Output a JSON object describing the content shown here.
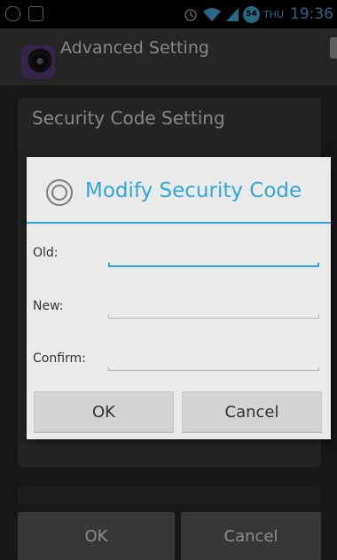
{
  "status_bar": {
    "day": "THU",
    "time": "19:36",
    "badge": "54",
    "icons": [
      "screenshot-icon",
      "image-icon",
      "alarm-icon",
      "wifi-icon",
      "signal-icon",
      "notification-badge-icon"
    ]
  },
  "action_bar": {
    "title": "Advanced Setting",
    "app_icon": "camera-app-icon"
  },
  "background": {
    "section_title": "Security Code Setting",
    "ok_label": "OK",
    "cancel_label": "Cancel"
  },
  "dialog": {
    "title": "Modify Security Code",
    "title_icon": "circle-chevron-icon",
    "fields": [
      {
        "label": "Old:",
        "value": "",
        "focused": true
      },
      {
        "label": "New:",
        "value": "",
        "focused": false
      },
      {
        "label": "Confirm:",
        "value": "",
        "focused": false
      }
    ],
    "ok_label": "OK",
    "cancel_label": "Cancel"
  },
  "colors": {
    "accent": "#33a6d8",
    "dialog_bg": "#eaeaea",
    "status_text": "#3fa9d6"
  }
}
